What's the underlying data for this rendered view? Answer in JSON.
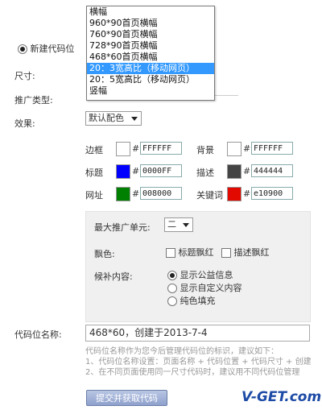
{
  "new_slot_radio_label": "新建代码位",
  "labels": {
    "size": "尺寸:",
    "promo_type": "推广类型:",
    "effect": "效果:",
    "slot_name": "代码位名称:"
  },
  "size_dropdown": {
    "options": [
      "横幅",
      "960*90首页横幅",
      "760*90首页横幅",
      "728*90首页横幅",
      "468*60首页横幅",
      "20：3宽高比（移动网页）",
      "20：5宽高比（移动网页）",
      "竖幅"
    ],
    "selected_index": 5
  },
  "effect_select": {
    "value": "默认配色"
  },
  "colors": {
    "border": {
      "label": "边框",
      "hex": "FFFFFF",
      "swatch": "#ffffff"
    },
    "background": {
      "label": "背景",
      "hex": "FFFFFF",
      "swatch": "#ffffff"
    },
    "title": {
      "label": "标题",
      "hex": "0000FF",
      "swatch": "#0000ff"
    },
    "description": {
      "label": "描述",
      "hex": "444444",
      "swatch": "#444444"
    },
    "url": {
      "label": "网址",
      "hex": "008000",
      "swatch": "#008000"
    },
    "keyword": {
      "label": "关键词",
      "hex": "e10900",
      "swatch": "#e10900"
    }
  },
  "hash_symbol": "#",
  "panel": {
    "max_units_label": "最大推广单元:",
    "max_units_value": "二",
    "float_red_label": "飘色:",
    "title_float_red": "标题飘红",
    "desc_float_red": "描述飘红",
    "fill_label": "候补内容:",
    "fill_options": [
      "显示公益信息",
      "显示自定义内容",
      "纯色填充"
    ],
    "fill_selected_index": 0
  },
  "slot_name_value": "468*60，创建于2013-7-4",
  "help_lines": [
    "代码位名称作为您今后管理代码位的标识，建议如下：",
    "1、代码位名称设置：页面名称 + 代码位置 + 代码尺寸 + 创建",
    "2、在不同页面使用同一尺寸代码时，建议用不同代码位管理"
  ],
  "submit_label": "提交并获取代码",
  "watermark": "V-GET.com"
}
